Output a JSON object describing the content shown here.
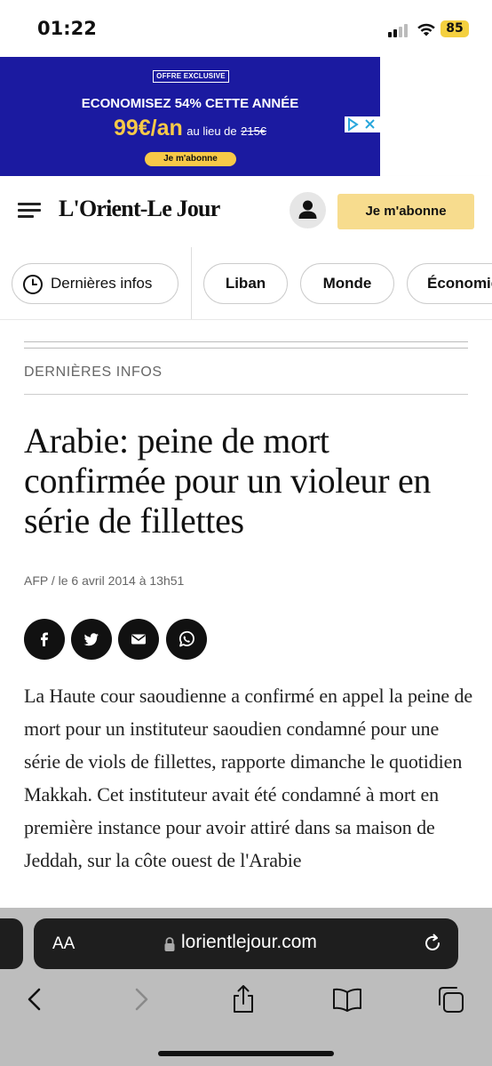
{
  "status_bar": {
    "time": "01:22",
    "battery": "85"
  },
  "ad": {
    "badge": "OFFRE EXCLUSIVE",
    "headline": "ECONOMISEZ 54% CETTE ANNÉE",
    "price": "99€/an",
    "compare_text": "au lieu de",
    "old_price": "215€",
    "cta": "Je m'abonne",
    "choices_icon": "adchoices-icon"
  },
  "header": {
    "logo": "L'Orient-Le Jour",
    "subscribe": "Je m'abonne"
  },
  "categories": {
    "latest": "Dernières infos",
    "items": [
      "Liban",
      "Monde",
      "Économie"
    ]
  },
  "article": {
    "section": "DERNIÈRES INFOS",
    "headline": "Arabie: peine de mort confirmée pour un violeur en série de fillettes",
    "byline": "AFP / le 6 avril 2014 à 13h51",
    "body": "La Haute cour saoudienne a confirmé en appel la peine de mort pour un instituteur saoudien condamné pour une série de viols de fillettes, rapporte dimanche le quotidien Makkah. Cet instituteur avait été condamné à mort en première instance pour avoir attiré dans sa maison de Jeddah, sur la côte ouest de l'Arabie"
  },
  "browser": {
    "aa_label": "AA",
    "url": "lorientlejour.com"
  },
  "colors": {
    "ad_background": "#1b1aa0",
    "ad_accent": "#f7c948",
    "subscribe_button": "#f7dc8e",
    "share_button": "#111111"
  }
}
